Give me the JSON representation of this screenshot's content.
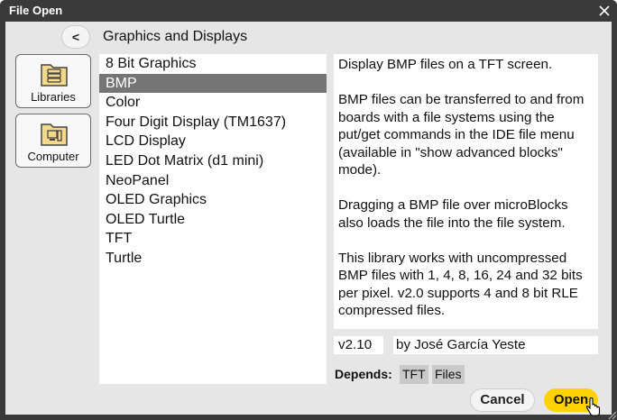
{
  "window": {
    "title": "File Open"
  },
  "nav": {
    "back_label": "<",
    "breadcrumb": "Graphics and Displays"
  },
  "sources": [
    {
      "label": "Libraries",
      "icon": "libraries-folder-icon"
    },
    {
      "label": "Computer",
      "icon": "computer-folder-icon"
    }
  ],
  "files": [
    {
      "label": "8 Bit Graphics",
      "selected": false
    },
    {
      "label": "BMP",
      "selected": true
    },
    {
      "label": "Color",
      "selected": false
    },
    {
      "label": "Four Digit Display (TM1637)",
      "selected": false
    },
    {
      "label": "LCD Display",
      "selected": false
    },
    {
      "label": "LED Dot Matrix (d1 mini)",
      "selected": false
    },
    {
      "label": "NeoPanel",
      "selected": false
    },
    {
      "label": "OLED Graphics",
      "selected": false
    },
    {
      "label": "OLED Turtle",
      "selected": false
    },
    {
      "label": "TFT",
      "selected": false
    },
    {
      "label": "Turtle",
      "selected": false
    }
  ],
  "details": {
    "description": "Display BMP files on a TFT screen.\n\nBMP files can be transferred to and from boards with a file systems using the put/get commands in the IDE file menu (available in \"show advanced blocks\" mode).\n\nDragging a BMP file over microBlocks also loads the file into the file system.\n\nThis library works with uncompressed BMP files with 1, 4, 8, 16, 24 and 32 bits per pixel. v2.0 supports 4 and 8 bit RLE compressed files.",
    "version": "v2.10",
    "author": "by José García Yeste",
    "depends_label": "Depends:",
    "depends": [
      "TFT",
      "Files"
    ]
  },
  "buttons": {
    "cancel": "Cancel",
    "open": "Open"
  },
  "colors": {
    "titlebar": "#3a3a3a",
    "panel": "#e6e6e6",
    "selection": "#757575",
    "open_button": "#ffd200",
    "folder_icon": "#f5d98b"
  }
}
